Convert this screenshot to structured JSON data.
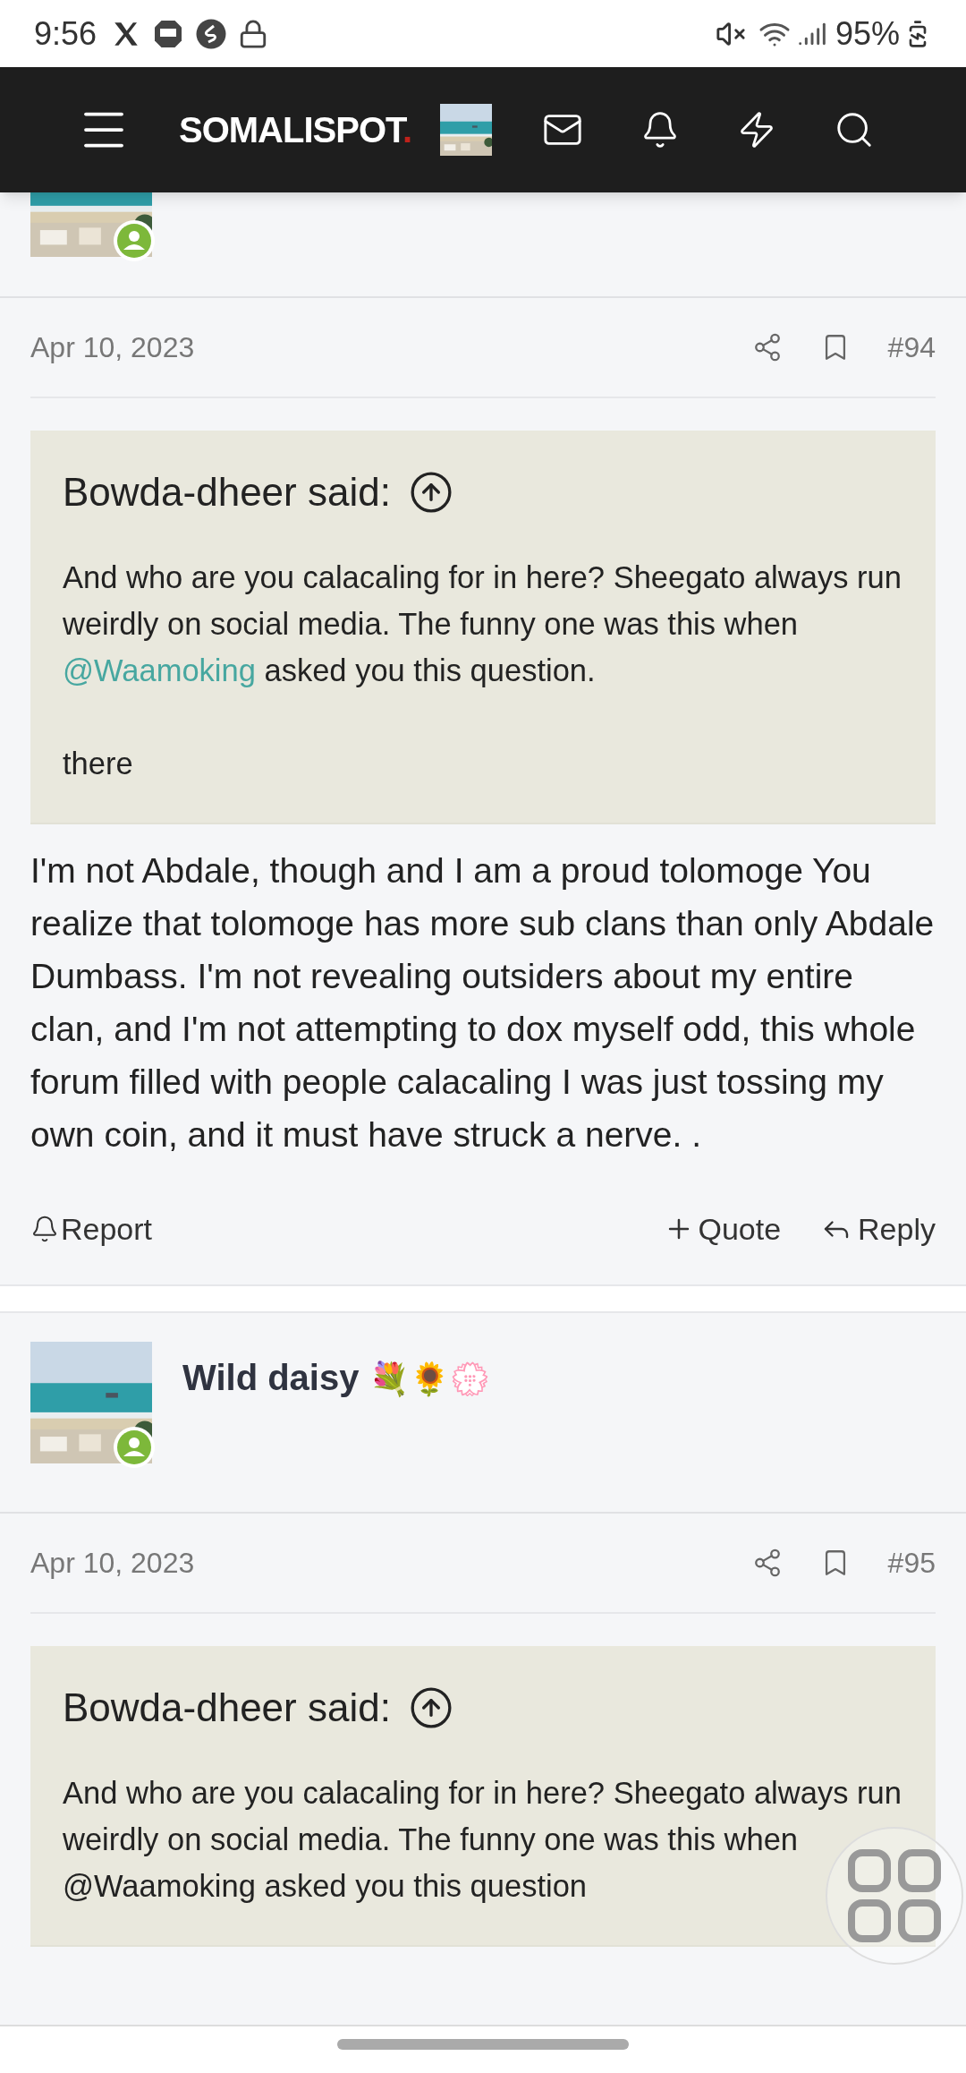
{
  "status_bar": {
    "time": "9:56",
    "battery": "95%"
  },
  "header": {
    "logo": "SOMALISPOT",
    "logo_dot": "."
  },
  "posts": [
    {
      "date": "Apr 10, 2023",
      "number": "#94",
      "quote": {
        "author": "Bowda-dheer said:",
        "paragraphs": [
          [
            {
              "kind": "text",
              "text": "And who are you calacaling for in here? Sheegato always run weirdly on social media. The funny one was this when "
            },
            {
              "kind": "mention",
              "text": "@Waamoking"
            },
            {
              "kind": "text",
              "text": " asked you this question."
            }
          ],
          [
            {
              "kind": "text",
              "text": "there"
            }
          ]
        ]
      },
      "body": "I'm not Abdale, though and I am a proud tolomoge You realize that tolomoge has more sub clans than only Abdale Dumbass. I'm not revealing outsiders about my entire clan, and I'm not attempting to dox myself odd, this whole forum filled with people calacaling I was just tossing my own coin, and it must have struck a nerve. .",
      "actions": {
        "report": "Report",
        "quote": "Quote",
        "reply": "Reply"
      }
    },
    {
      "author": "Wild daisy",
      "author_emoji": "💐🌻💮",
      "date": "Apr 10, 2023",
      "number": "#95",
      "quote": {
        "author": "Bowda-dheer said:",
        "paragraphs": [
          [
            {
              "kind": "text",
              "text": "And who are you calacaling for in here? Sheegato always run weirdly on social media. The funny one was this when @Waamoking asked you this question"
            }
          ]
        ]
      }
    }
  ]
}
